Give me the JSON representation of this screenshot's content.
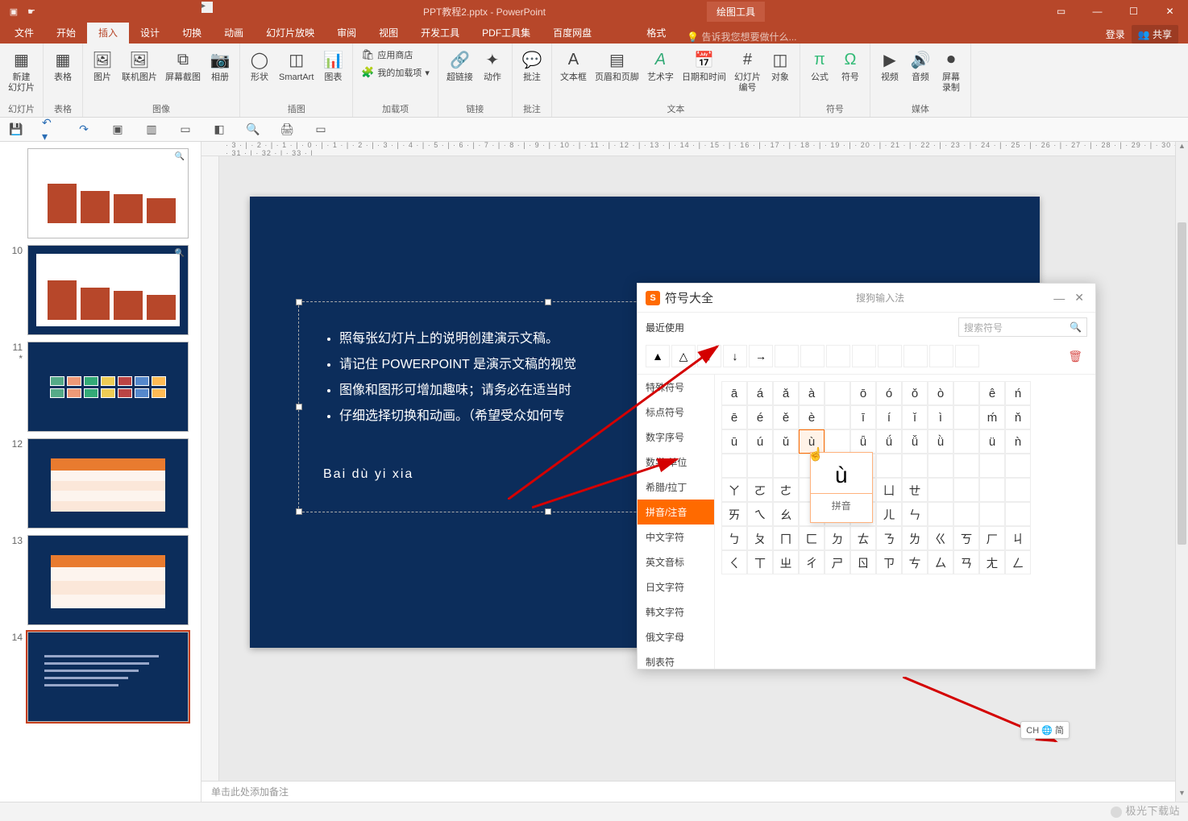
{
  "title": {
    "filename": "PPT教程2.pptx - PowerPoint",
    "context_tool": "绘图工具"
  },
  "win": {
    "login": "登录",
    "share": "共享"
  },
  "tabs": [
    "文件",
    "开始",
    "插入",
    "设计",
    "切换",
    "动画",
    "幻灯片放映",
    "审阅",
    "视图",
    "开发工具",
    "PDF工具集",
    "百度网盘"
  ],
  "context_tab": "格式",
  "tell_me": "告诉我您想要做什么...",
  "ribbon": {
    "groups": {
      "slides": {
        "label": "幻灯片",
        "new_slide": "新建\n幻灯片"
      },
      "tables": {
        "label": "表格",
        "table": "表格"
      },
      "images": {
        "label": "图像",
        "picture": "图片",
        "online_pic": "联机图片",
        "screenshot": "屏幕截图",
        "album": "相册"
      },
      "illus": {
        "label": "插图",
        "shapes": "形状",
        "smartart": "SmartArt",
        "chart": "图表"
      },
      "addins": {
        "label": "加载项",
        "store": "应用商店",
        "myaddins": "我的加载项"
      },
      "links": {
        "label": "链接",
        "hyperlink": "超链接",
        "action": "动作"
      },
      "comments": {
        "label": "批注",
        "comment": "批注"
      },
      "text": {
        "label": "文本",
        "textbox": "文本框",
        "header_footer": "页眉和页脚",
        "wordart": "艺术字",
        "datetime": "日期和时间",
        "slide_no": "幻灯片\n编号",
        "object": "对象"
      },
      "symbols": {
        "label": "符号",
        "equation": "公式",
        "symbol": "符号"
      },
      "media": {
        "label": "媒体",
        "video": "视频",
        "audio": "音频",
        "screen_rec": "屏幕\n录制"
      }
    }
  },
  "ruler_h": "· 3 · | · 2 · | · 1 · | · 0 · | · 1 · | · 2 · | · 3 · | · 4 · | · 5 · | · 6 · | · 7 · | · 8 · | · 9 · | · 10 · | · 11 · | · 12 · | · 13 · | · 14 · | · 15 · | · 16 · | · 17 · | · 18 · | · 19 · | · 20 · | · 21 · | · 22 · | · 23 · | · 24 · | · 25 · | · 26 · | · 27 · | · 28 · | · 29 · | · 30 · | · 31 · | · 32 · | · 33 · |",
  "thumbs": [
    {
      "num": "",
      "type": "white-chart"
    },
    {
      "num": "10",
      "type": "chart"
    },
    {
      "num": "11",
      "star": "*",
      "type": "imgs"
    },
    {
      "num": "12",
      "type": "table-color"
    },
    {
      "num": "13",
      "type": "table-plain"
    },
    {
      "num": "14",
      "type": "text",
      "selected": true
    }
  ],
  "slide_text": {
    "bullets": [
      "照每张幻灯片上的说明创建演示文稿。",
      "请记住 POWERPOINT 是演示文稿的视觉",
      "图像和图形可增加趣味；请务必在适当时",
      "仔细选择切换和动画。（希望受众如何专"
    ],
    "free": "Bai  dù  yi  xia"
  },
  "notes_placeholder": "单击此处添加备注",
  "symbol_dialog": {
    "title": "符号大全",
    "ime": "搜狗输入法",
    "recent_label": "最近使用",
    "search_placeholder": "搜索符号",
    "recent": [
      "▲",
      "△",
      "↑",
      "↓",
      "→"
    ],
    "categories": [
      "特殊符号",
      "标点符号",
      "数字序号",
      "数学/单位",
      "希腊/拉丁",
      "拼音/注音",
      "中文字符",
      "英文音标",
      "日文字符",
      "韩文字符",
      "俄文字母",
      "制表符"
    ],
    "active_cat": "拼音/注音",
    "grid": [
      [
        "ā",
        "á",
        "ǎ",
        "à",
        "",
        "ō",
        "ó",
        "ǒ",
        "ò",
        "",
        "ê",
        "ń"
      ],
      [
        "ē",
        "é",
        "ě",
        "è",
        "",
        "ī",
        "í",
        "ǐ",
        "ì",
        "",
        "ḿ",
        "ň"
      ],
      [
        "ū",
        "ú",
        "ǔ",
        "ù",
        "",
        "ǖ",
        "ǘ",
        "ǚ",
        "ǜ",
        "",
        "ü",
        "ǹ"
      ],
      [
        "",
        "",
        "",
        "",
        "",
        "",
        "",
        "",
        "",
        "",
        "",
        ""
      ],
      [
        "ㄚ",
        "ㄛ",
        "ㄜ",
        "",
        "",
        "ㄨ",
        "ㄩ",
        "ㄝ",
        "",
        "",
        "",
        ""
      ],
      [
        "ㄞ",
        "ㄟ",
        "ㄠ",
        "",
        "",
        "ㄡ",
        "ㄦ",
        "ㄣ",
        "",
        "",
        "",
        ""
      ],
      [
        "ㄅ",
        "ㄆ",
        "ㄇ",
        "ㄈ",
        "ㄉ",
        "ㄊ",
        "ㄋ",
        "ㄌ",
        "ㄍ",
        "ㄎ",
        "ㄏ",
        "ㄐ"
      ],
      [
        "ㄑ",
        "ㄒ",
        "ㄓ",
        "ㄔ",
        "ㄕ",
        "ㄖ",
        "ㄗ",
        "ㄘ",
        "ㄙ",
        "ㄢ",
        "ㄤ",
        "ㄥ"
      ]
    ],
    "selected_cell": {
      "row": 2,
      "col": 3
    },
    "tooltip": {
      "char": "ù",
      "label": "拼音"
    }
  },
  "ime_badge": "CH 🌐 简",
  "watermark": "极光下载站"
}
